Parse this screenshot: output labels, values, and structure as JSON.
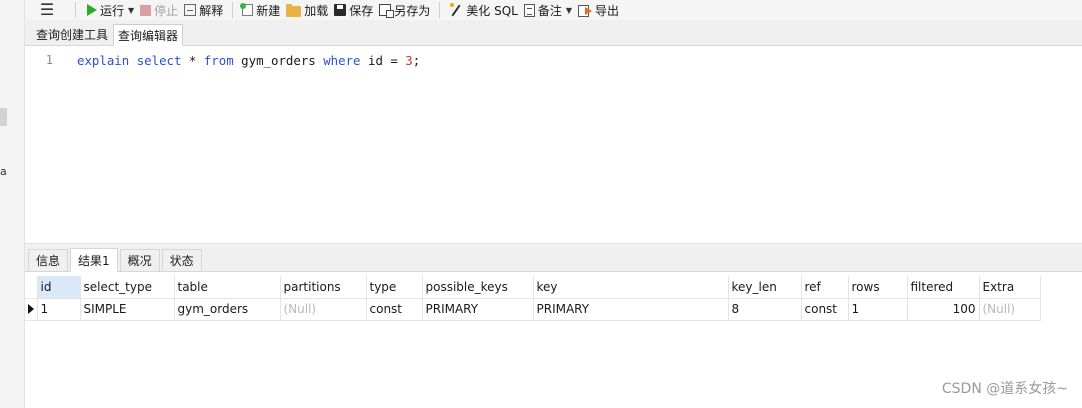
{
  "left_panel": {
    "cut_letter": "a"
  },
  "toolbar": {
    "run": "运行",
    "stop": "停止",
    "explain": "解释",
    "new": "新建",
    "load": "加载",
    "save": "保存",
    "save_as": "另存为",
    "beautify": "美化 SQL",
    "note": "备注",
    "export": "导出"
  },
  "editor_tabs": [
    {
      "label": "查询创建工具"
    },
    {
      "label": "查询编辑器"
    }
  ],
  "editor": {
    "line_number": "1",
    "tokens": {
      "explain": "explain",
      "select": "select",
      "star_from": " * ",
      "from": "from",
      "table": " gym_orders ",
      "where": "where",
      "cond": " id = ",
      "value": "3",
      "end": ";"
    }
  },
  "result_tabs": [
    {
      "label": "信息"
    },
    {
      "label": "结果1"
    },
    {
      "label": "概况"
    },
    {
      "label": "状态"
    }
  ],
  "grid": {
    "columns": [
      "id",
      "select_type",
      "table",
      "partitions",
      "type",
      "possible_keys",
      "key",
      "key_len",
      "ref",
      "rows",
      "filtered",
      "Extra"
    ],
    "row": [
      "1",
      "SIMPLE",
      "gym_orders",
      "(Null)",
      "const",
      "PRIMARY",
      "PRIMARY",
      "8",
      "const",
      "1",
      "100",
      "(Null)"
    ]
  },
  "watermark": "CSDN @道系女孩~"
}
